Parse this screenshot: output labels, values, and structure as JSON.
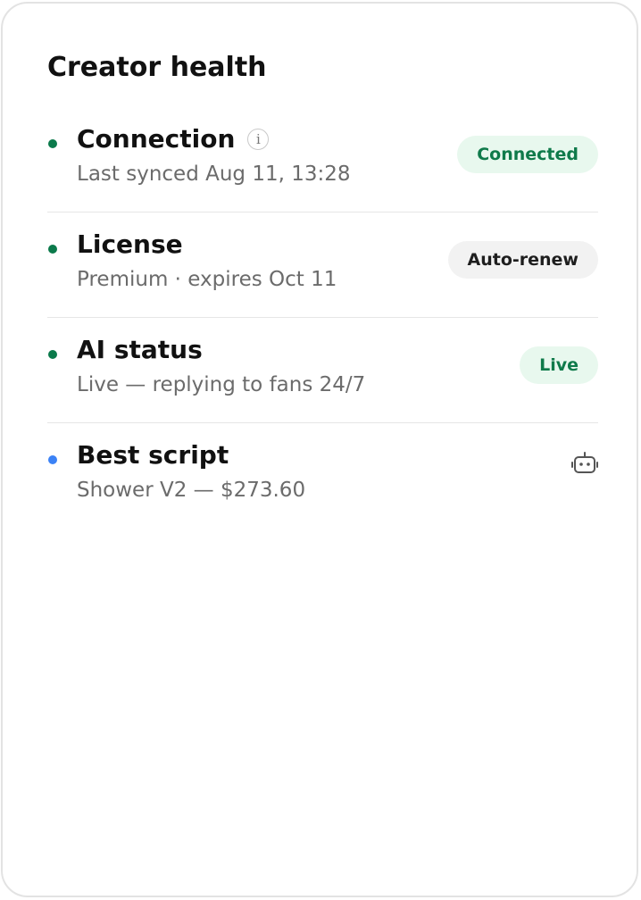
{
  "card": {
    "title": "Creator health"
  },
  "colors": {
    "status_green": "#0b7a4b",
    "status_blue": "#3b82f6",
    "badge_green_bg": "#e8f8ee",
    "badge_green_text": "#0f7a4a",
    "badge_gray_bg": "#f2f2f2"
  },
  "items": [
    {
      "title": "Connection",
      "subtitle": "Last synced Aug 11, 13:28",
      "status_color": "green",
      "info_icon": "info-icon",
      "info_glyph": "i",
      "badge": "Connected"
    },
    {
      "title": "License",
      "subtitle": "Premium · expires Oct 11",
      "status_color": "green",
      "badge": "Auto-renew"
    },
    {
      "title": "AI status",
      "subtitle": "Live — replying to fans 24/7",
      "status_color": "green",
      "badge": "Live"
    },
    {
      "title": "Best script",
      "subtitle": "Shower V2 — $273.60",
      "status_color": "blue",
      "icon": "robot-icon"
    }
  ]
}
